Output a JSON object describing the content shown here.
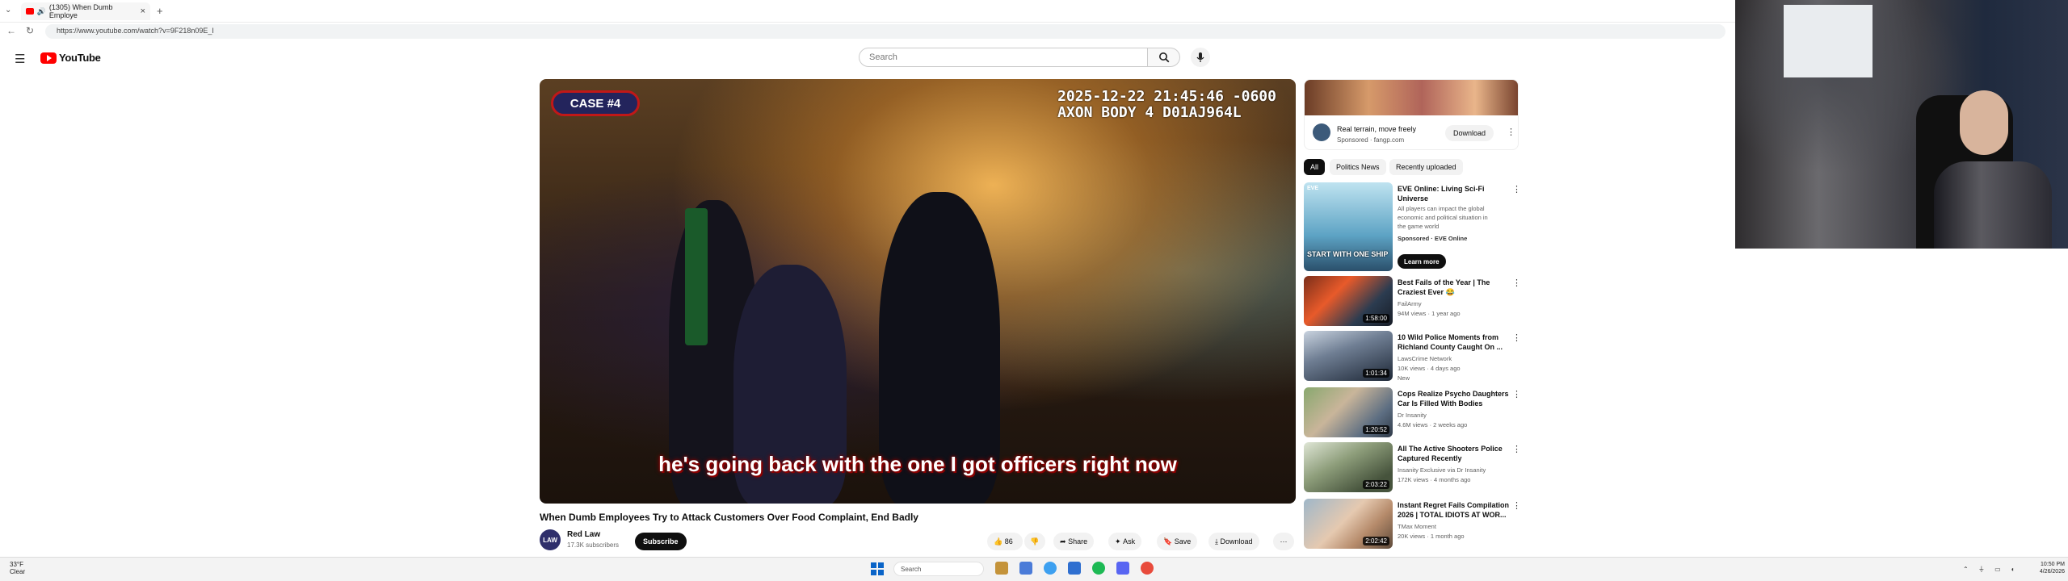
{
  "browser": {
    "tab_title": "(1305) When Dumb Employe",
    "url": "https://www.youtube.com/watch?v=9F218n09E_I",
    "new_tab": "+",
    "close": "×"
  },
  "youtube": {
    "wordmark": "YouTube",
    "search_placeholder": "Search"
  },
  "video": {
    "case_badge": "CASE #4",
    "stamp_line1": "2025-12-22 21:45:46 -0600",
    "stamp_line2": "AXON BODY 4 D01AJ964L",
    "subtitle": "he's going back with the one I got officers right now",
    "title": "When Dumb Employees Try to Attack Customers Over Food Complaint, End Badly",
    "channel": "Red Law",
    "channel_avatar_text": "LAW",
    "subscribers": "17.3K subscribers",
    "subscribe": "Subscribe",
    "likes": "86",
    "share": "Share",
    "ask": "Ask",
    "save": "Save",
    "download": "Download",
    "more": "···"
  },
  "ad": {
    "title": "Real terrain, move freely",
    "sponsor": "Sponsored · fangp.com",
    "download": "Download"
  },
  "chips": [
    "All",
    "Politics News",
    "Recently uploaded"
  ],
  "recommendations": [
    {
      "title": "EVE Online: Living Sci-Fi Universe",
      "meta1": "All players can impact the global economic and political situation in the game world",
      "meta2": "Sponsored · EVE Online",
      "cta": "Learn more",
      "thumb_text": "START WITH ONE SHIP",
      "duration": ""
    },
    {
      "title": "Best Fails of the Year | The Craziest Ever 😂",
      "meta1": "FailArmy",
      "meta2": "94M views · 1 year ago",
      "duration": "1:58:00"
    },
    {
      "title": "10 Wild Police Moments from Richland County Caught On ...",
      "meta1": "LawsCrime Network",
      "meta2": "10K views · 4 days ago",
      "meta3": "New",
      "duration": "1:01:34"
    },
    {
      "title": "Cops Realize Psycho Daughters Car Is Filled With Bodies",
      "meta1": "Dr Insanity",
      "meta2": "4.6M views · 2 weeks ago",
      "duration": "1:20:52"
    },
    {
      "title": "All The Active Shooters Police Captured Recently",
      "meta1": "Insanity Exclusive via Dr Insanity",
      "meta2": "172K views · 4 months ago",
      "duration": "2:03:22"
    },
    {
      "title": "Instant Regret Fails Compilation 2026 | TOTAL IDIOTS AT WOR...",
      "meta1": "TMax Moment",
      "meta2": "20K views · 1 month ago",
      "duration": "2:02:42"
    }
  ],
  "taskbar": {
    "weather_temp": "33°F",
    "weather_desc": "Clear",
    "search": "Search",
    "time": "10:50 PM",
    "date": "4/26/2026",
    "tray": "⌃ ⏚ ▭ ◖"
  }
}
